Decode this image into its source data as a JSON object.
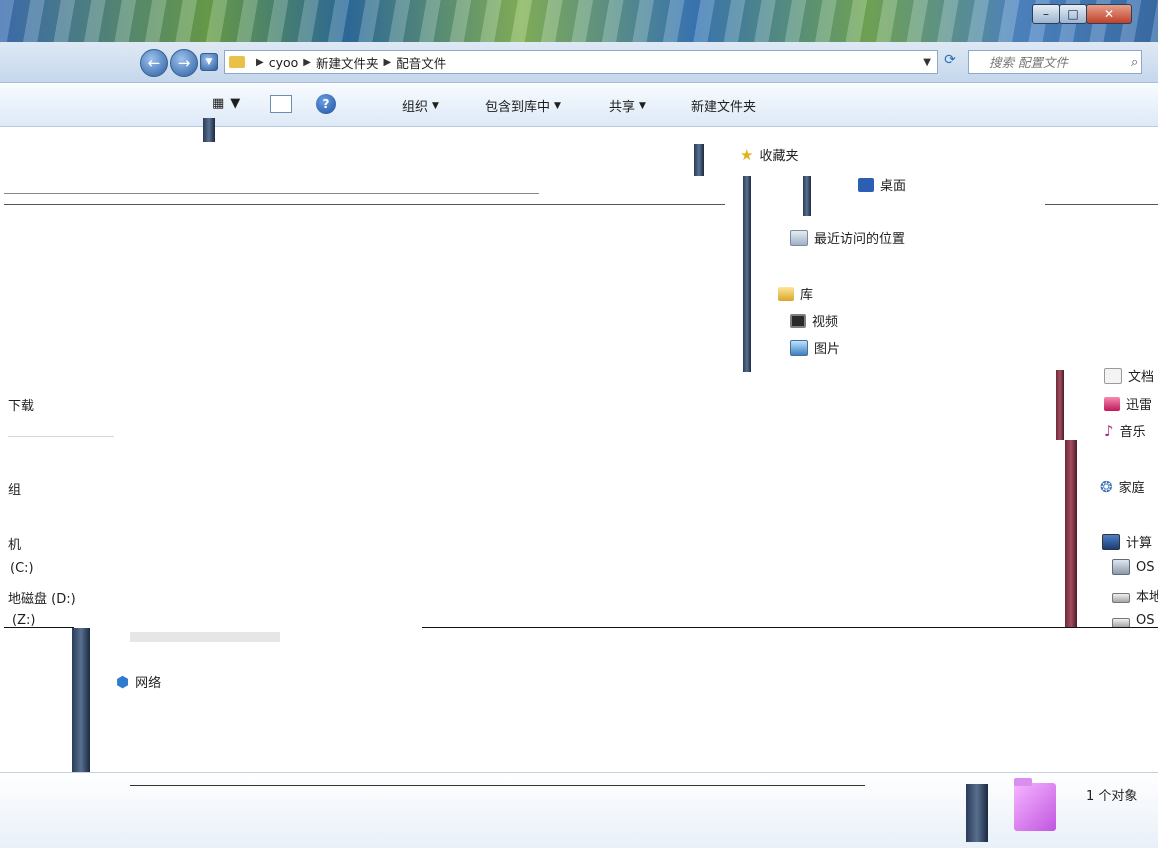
{
  "window": {
    "controls": [
      "–",
      "□",
      "✕"
    ]
  },
  "nav": {
    "back_icon": "back-arrow-icon",
    "forward_icon": "forward-arrow-icon",
    "breadcrumbs": [
      "cyoo",
      "新建文件夹",
      "配音文件"
    ],
    "search_placeholder": "搜索 配置文件"
  },
  "toolbar": {
    "organize": "组织",
    "include_in_library": "包含到库中",
    "share": "共享",
    "new_folder": "新建文件夹"
  },
  "nav_pane": {
    "favorites": "收藏夹",
    "recent": "最近访问的位置",
    "libraries": "库",
    "videos": "视频",
    "pictures": "图片",
    "documents": "文档",
    "xunlei": "迅雷",
    "music": "音乐",
    "homegroup": "家庭",
    "computer": "计算",
    "os_c": "OS",
    "local_disk": "本地",
    "os_z": "OS",
    "network": "网络",
    "downloads": "下载",
    "group_trunc": "组",
    "machine_trunc": "机",
    "drive_c": "(C:)",
    "drive_d": "地磁盘 (D:)",
    "drive_z": "(Z:)",
    "desktop": "桌面"
  },
  "status": {
    "count": "1 个对象"
  },
  "colors": {
    "accent": "#2b6fb8",
    "folder": "#e9c148",
    "status_folder": "#c056e0"
  }
}
